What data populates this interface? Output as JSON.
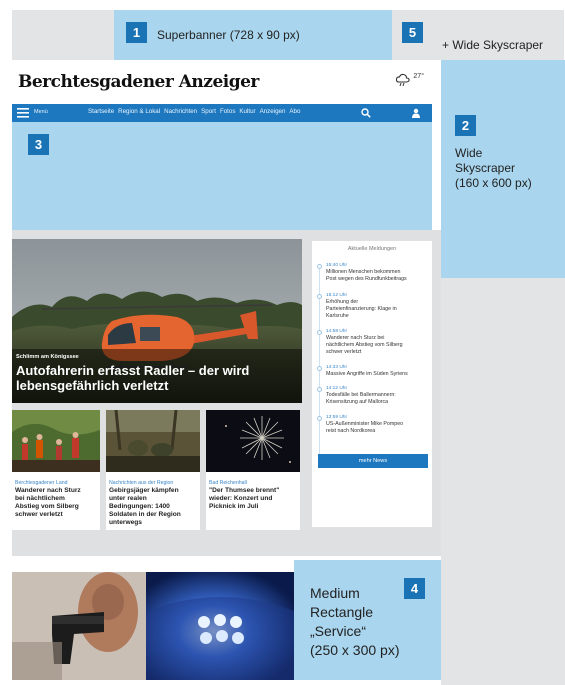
{
  "zones": {
    "superbanner": {
      "number": "1",
      "label": "Superbanner (728 x 90 px)"
    },
    "wide_skyscraper_top": {
      "number": "5",
      "label": "+ Wide Skyscraper"
    },
    "wide_skyscraper": {
      "number": "2",
      "label_lines": [
        "Wide",
        "Skyscraper",
        "(160 x 600 px)"
      ]
    },
    "billboard": {
      "number": "3"
    },
    "medium_rectangle": {
      "number": "4",
      "label_lines": [
        "Medium",
        "Rectangle",
        "„Service“",
        "(250 x 300 px)"
      ]
    }
  },
  "site": {
    "logo": "Berchtesgadener Anzeiger",
    "weather_temp": "27°",
    "menu_label": "Menü",
    "nav": [
      "Startseite",
      "Region & Lokal",
      "Nachrichten",
      "Sport",
      "Fotos",
      "Kultur",
      "Anzeigen",
      "Abo"
    ]
  },
  "hero": {
    "category": "Schlimm am Königssee",
    "title_lines": [
      "Autofahrerin erfasst Radler – der wird",
      "lebensgefährlich verletzt"
    ]
  },
  "teasers": [
    {
      "category": "Berchtesgadener Land",
      "title_lines": [
        "Wanderer nach Sturz",
        "bei nächtlichem",
        "Abstieg vom Silberg",
        "schwer verletzt"
      ]
    },
    {
      "category": "Nachrichten aus der Region",
      "title_lines": [
        "Gebirgsjäger kämpfen",
        "unter realen",
        "Bedingungen: 1400",
        "Soldaten in der Region",
        "unterwegs"
      ]
    },
    {
      "category": "Bad Reichenhall",
      "title_lines": [
        "\"Der Thumsee brennt\"",
        "wieder: Konzert und",
        "Picknick im Juli"
      ]
    }
  ],
  "sidebar": {
    "heading": "Aktuelle Meldungen",
    "items": [
      {
        "time": "15:40 Uhr",
        "text_lines": [
          "Millionen Menschen bekommen",
          "Post wegen des Rundfunkbeitrags"
        ]
      },
      {
        "time": "15:12 Uhr",
        "text_lines": [
          "Erhöhung der",
          "Parteienfinanzierung: Klage in",
          "Karlsruhe"
        ]
      },
      {
        "time": "14:58 Uhr",
        "text_lines": [
          "Wanderer nach Sturz bei",
          "nächtlichem Abstieg vom Silberg",
          "schwer verletzt"
        ]
      },
      {
        "time": "14:33 Uhr",
        "text_lines": [
          "Massive Angriffe im Süden Syriens"
        ]
      },
      {
        "time": "14:12 Uhr",
        "text_lines": [
          "Todesfälle bei Ballermannern:",
          "Krisensitzung auf Mallorca"
        ]
      },
      {
        "time": "13:59 Uhr",
        "text_lines": [
          "US-Außenminister Mike Pompeo",
          "reist nach Nordkorea"
        ]
      }
    ],
    "more_button": "mehr News"
  }
}
